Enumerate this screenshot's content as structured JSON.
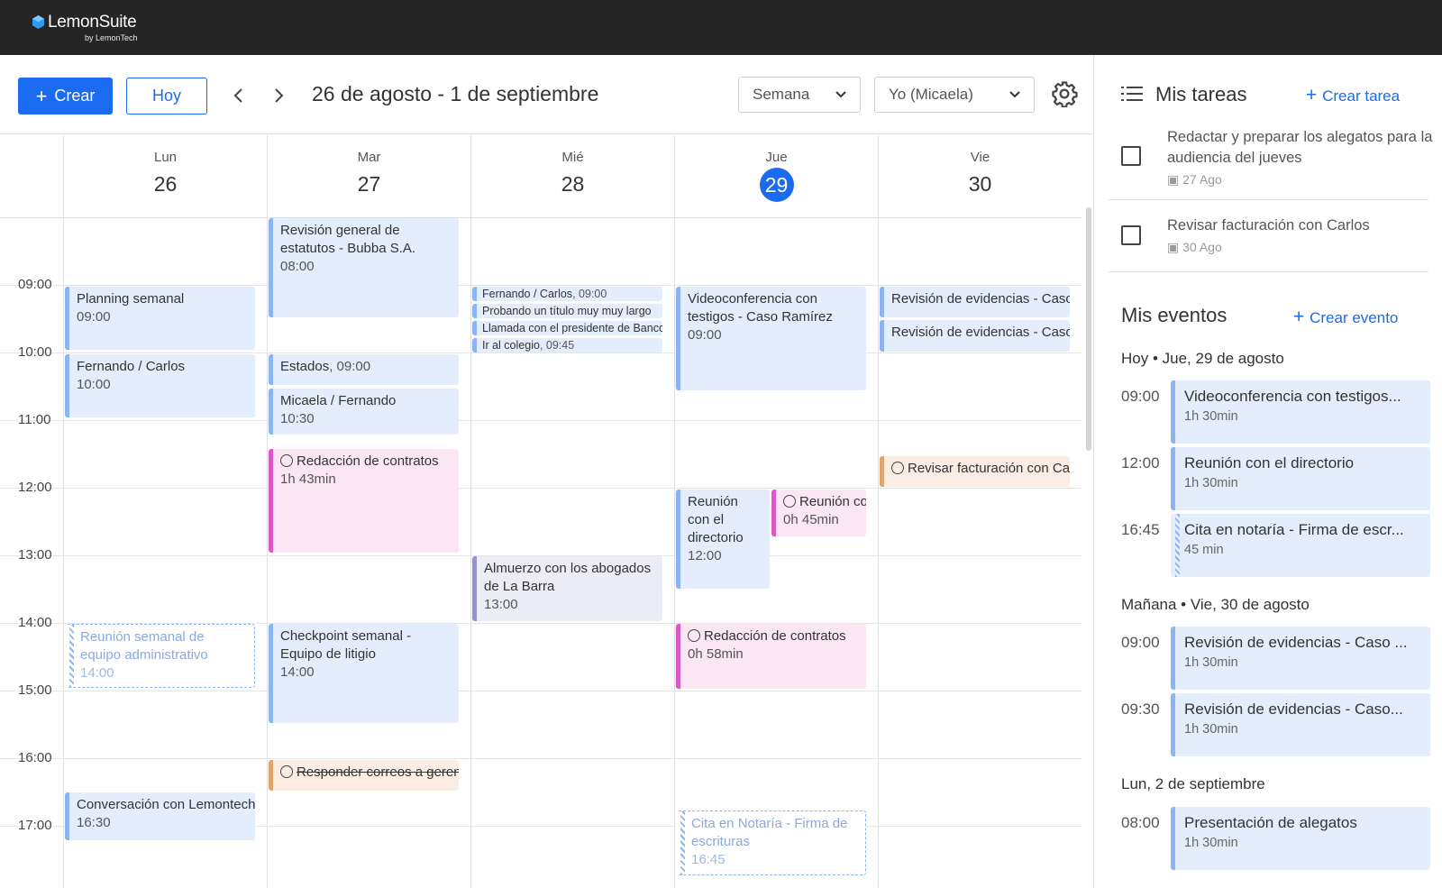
{
  "app": {
    "name": "LemonSuite",
    "byline": "by LemonTech"
  },
  "toolbar": {
    "create_label": "Crear",
    "today_label": "Hoy",
    "range": "26 de agosto - 1 de septiembre",
    "view_select": "Semana",
    "user_select": "Yo (Micaela)"
  },
  "days": [
    {
      "name": "Lun",
      "date": "26"
    },
    {
      "name": "Mar",
      "date": "27"
    },
    {
      "name": "Mié",
      "date": "28"
    },
    {
      "name": "Jue",
      "date": "29"
    },
    {
      "name": "Vie",
      "date": "30"
    }
  ],
  "hours": [
    "09:00",
    "10:00",
    "11:00",
    "12:00",
    "13:00",
    "14:00",
    "15:00",
    "16:00",
    "17:00"
  ],
  "events": {
    "lun_planning": {
      "title": "Planning semanal",
      "sub": "09:00"
    },
    "lun_fernando": {
      "title": "Fernando / Carlos",
      "sub": "10:00"
    },
    "lun_reunion": {
      "title": "Reunión semanal de equipo administrativo",
      "sub": "14:00"
    },
    "lun_conversacion": {
      "title": "Conversación con Lemontech",
      "sub": "16:30"
    },
    "mar_revision": {
      "title": "Revisión general de estatutos - Bubba S.A.",
      "sub": "08:00"
    },
    "mar_estados": {
      "title": "Estados",
      "sub": ", 09:00"
    },
    "mar_micaela": {
      "title": "Micaela / Fernando",
      "sub": "10:30"
    },
    "mar_redaccion": {
      "title": "Redacción de contratos",
      "sub": "1h 43min"
    },
    "mar_checkpoint": {
      "title": "Checkpoint semanal - Equipo de litigio",
      "sub": "14:00"
    },
    "mar_responder": {
      "title": "Responder correos a gerencia"
    },
    "mie_fernando": {
      "title": "Fernando / Carlos",
      "sub": ", 09:00"
    },
    "mie_probando": {
      "title": "Probando un título muy muy largo"
    },
    "mie_llamada": {
      "title": "Llamada con el presidente de Banco"
    },
    "mie_colegio": {
      "title": "Ir al colegio",
      "sub": ", 09:45"
    },
    "mie_almuerzo": {
      "title": "Almuerzo con los abogados de La Barra",
      "sub": "13:00"
    },
    "jue_video": {
      "title": "Videoconferencia con testigos - Caso Ramírez",
      "sub": "09:00"
    },
    "jue_reunion": {
      "title": "Reunión con el directorio",
      "sub": "12:00"
    },
    "jue_reunion2": {
      "title": "Reunión con",
      "sub": "0h 45min"
    },
    "jue_redaccion": {
      "title": "Redacción de contratos",
      "sub": "0h 58min"
    },
    "jue_cita": {
      "title": "Cita en Notaría - Firma de escrituras",
      "sub": "16:45"
    },
    "vie_rev1": {
      "title": "Revisión de evidencias - Caso Ramírez"
    },
    "vie_rev2": {
      "title": "Revisión de evidencias - Caso Ramírez"
    },
    "vie_facturacion": {
      "title": "Revisar facturación con Carlos"
    }
  },
  "panel": {
    "tasks_title": "Mis tareas",
    "create_task": "Crear tarea",
    "tasks": [
      {
        "title": "Redactar y preparar los alegatos para la audiencia del jueves",
        "date": "27 Ago"
      },
      {
        "title": "Revisar facturación con Carlos",
        "date": "30 Ago"
      }
    ],
    "events_title": "Mis eventos",
    "create_event": "Crear evento",
    "groups": [
      {
        "title": "Hoy • Jue, 29 de agosto",
        "items": [
          {
            "time": "09:00",
            "title": "Videoconferencia con testigos...",
            "duration": "1h 30min"
          },
          {
            "time": "12:00",
            "title": "Reunión con el directorio",
            "duration": "1h 30min"
          },
          {
            "time": "16:45",
            "title": "Cita en notaría - Firma de escr...",
            "duration": "45 min"
          }
        ]
      },
      {
        "title": "Mañana • Vie, 30 de agosto",
        "items": [
          {
            "time": "09:00",
            "title": "Revisión de evidencias - Caso ...",
            "duration": "1h 30min"
          },
          {
            "time": "09:30",
            "title": "Revisión de evidencias - Caso...",
            "duration": "1h 30min"
          }
        ]
      },
      {
        "title": "Lun, 2 de septiembre",
        "items": [
          {
            "time": "08:00",
            "title": "Presentación de alegatos",
            "duration": "1h 30min"
          }
        ]
      }
    ]
  },
  "colors": {
    "brand": "#1a6bf0",
    "topbar": "#252525",
    "event_blue": "#e3edfc",
    "event_pink": "#fbe7f4",
    "event_orange": "#fbede3",
    "event_lavender": "#ececf6"
  },
  "icons": [
    "cube-logo-icon",
    "plus-icon",
    "chevron-left-icon",
    "chevron-right-icon",
    "chevron-down-icon",
    "gear-icon",
    "list-icon",
    "timer-icon",
    "check-circle-icon",
    "checkbox-icon",
    "calendar-icon"
  ]
}
